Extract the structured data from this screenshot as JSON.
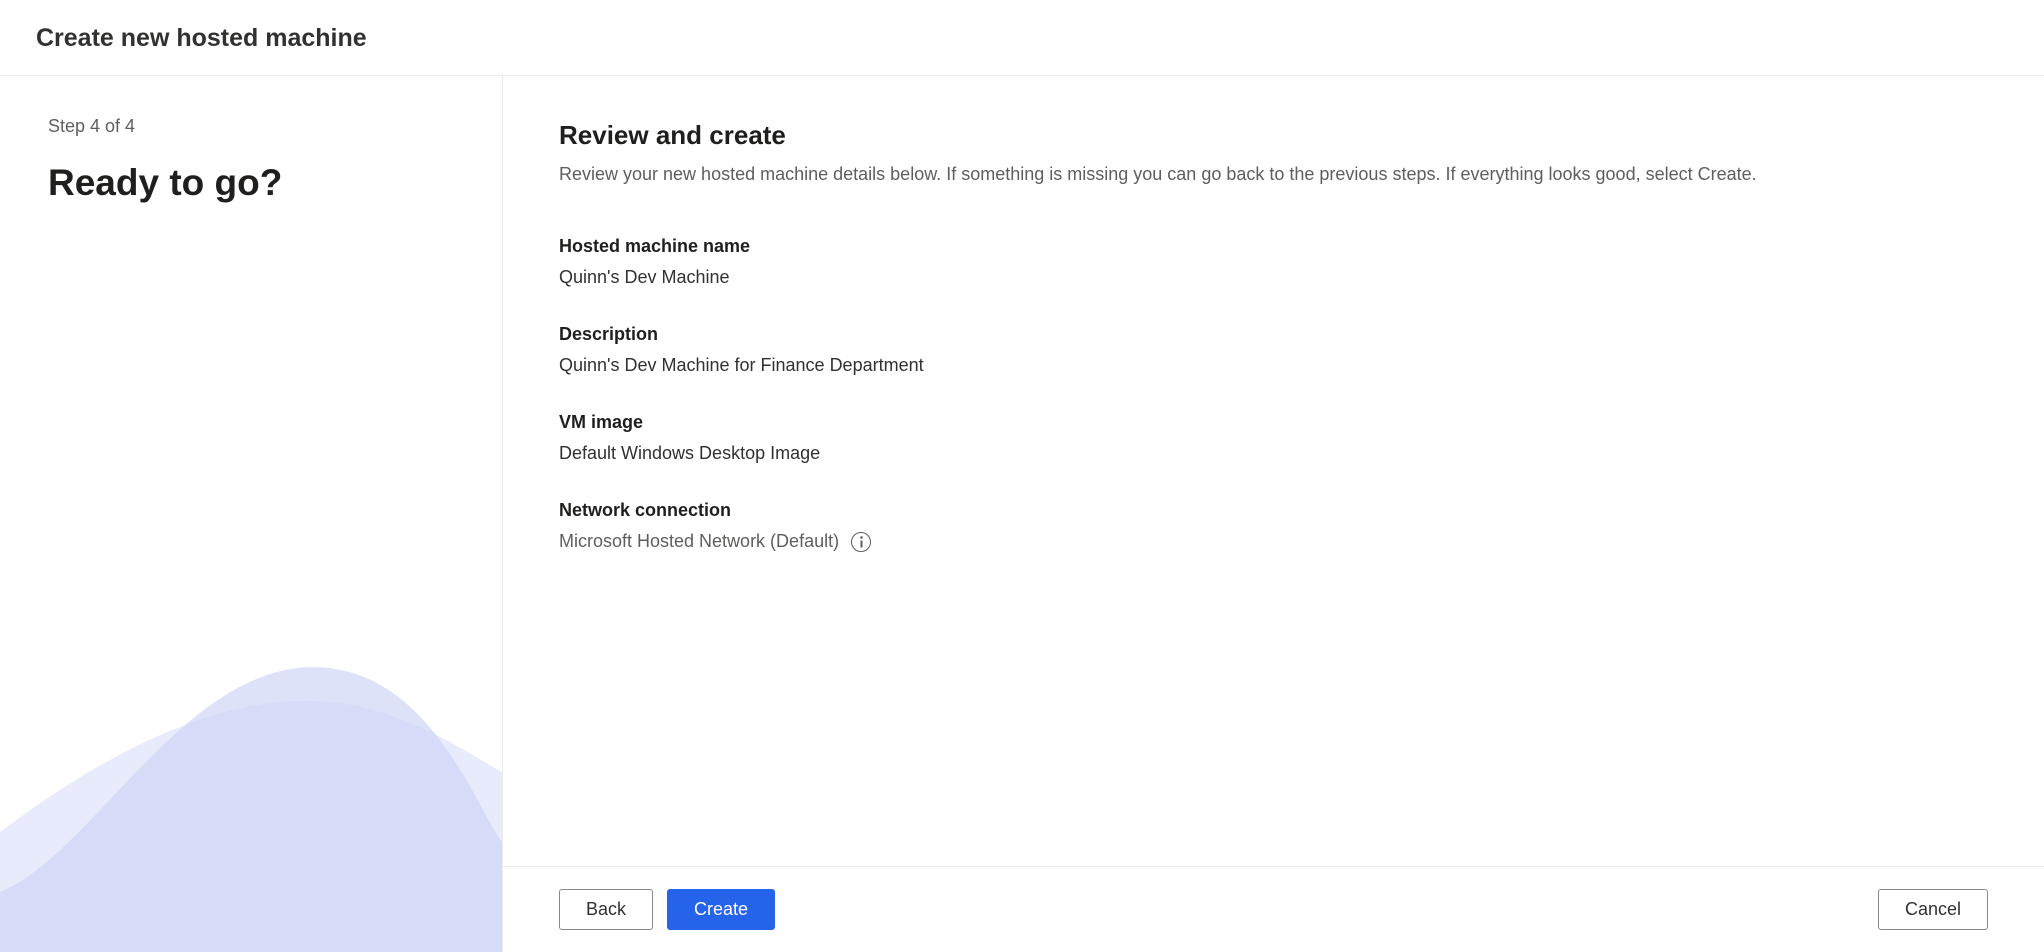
{
  "header": {
    "title": "Create new hosted machine"
  },
  "sidebar": {
    "step_indicator": "Step 4 of 4",
    "step_title": "Ready to go?"
  },
  "main": {
    "title": "Review and create",
    "subtitle": "Review your new hosted machine details below. If something is missing you can go back to the previous steps. If everything looks good, select Create.",
    "review": {
      "name_label": "Hosted machine name",
      "name_value": "Quinn's Dev Machine",
      "description_label": "Description",
      "description_value": "Quinn's Dev Machine for Finance Department",
      "vmimage_label": "VM image",
      "vmimage_value": "Default Windows Desktop Image",
      "network_label": "Network connection",
      "network_value": "Microsoft Hosted Network (Default)"
    }
  },
  "footer": {
    "back_label": "Back",
    "create_label": "Create",
    "cancel_label": "Cancel"
  }
}
